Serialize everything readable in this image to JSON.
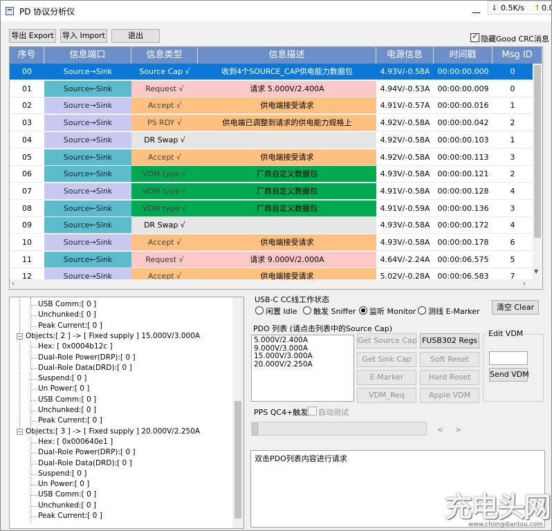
{
  "window": {
    "title": "PD 协议分析仪",
    "net_down": "0.5K/s",
    "net_up": "0.05"
  },
  "toolbar": {
    "export_label": "导出 Export",
    "import_label": "导入 Import",
    "exit_label": "退出",
    "hide_crc_label": "隐藏Good CRC消息"
  },
  "table": {
    "columns": [
      "序号",
      "信息端口",
      "信息类型",
      "信息描述",
      "电源信息",
      "时间戳",
      "Msg ID"
    ],
    "rows": [
      {
        "idx": "00",
        "port": "Source→Sink",
        "type": "Source Cap √",
        "desc": "收到4个SOURCE_CAP供电能力数据包",
        "power": "4.93V/-0.58A",
        "time": "00:00:00.000",
        "msg": "0",
        "type_color": "#0b78d8",
        "desc_color": "#0b78d8",
        "port_color": "#0b78d8"
      },
      {
        "idx": "01",
        "port": "Source←Sink",
        "type": "Request √",
        "desc": "请求 5.000V/2.400A",
        "power": "4.94V/-0.53A",
        "time": "00:00:00.009",
        "msg": "0",
        "type_color": "#ffc8c8",
        "desc_color": "#ffc8c8",
        "port_color": "#5cbccc"
      },
      {
        "idx": "02",
        "port": "Source→Sink",
        "type": "Accept √",
        "desc": "供电端接受请求",
        "power": "4.91V/-0.57A",
        "time": "00:00:00.016",
        "msg": "1",
        "type_color": "#ffc080",
        "desc_color": "#ffc080",
        "port_color": "#c8c8f0"
      },
      {
        "idx": "03",
        "port": "Source→Sink",
        "type": "PS RDY √",
        "desc": "供电端已调整到请求的供电能力规格上",
        "power": "4.92V/-0.58A",
        "time": "00:00:00.042",
        "msg": "2",
        "type_color": "#ffc080",
        "desc_color": "#ffc080",
        "port_color": "#c8c8f0"
      },
      {
        "idx": "04",
        "port": "Source→Sink",
        "type": "DR Swap √",
        "desc": "",
        "power": "4.92V/-0.58A",
        "time": "00:00:00.103",
        "msg": "1",
        "type_color": "#e6e6e6",
        "desc_color": "#e6e6e6",
        "port_color": "#c8c8f0"
      },
      {
        "idx": "05",
        "port": "Source←Sink",
        "type": "Accept √",
        "desc": "供电端接受请求",
        "power": "4.92V/-0.58A",
        "time": "00:00:00.113",
        "msg": "3",
        "type_color": "#ffc080",
        "desc_color": "#ffc080",
        "port_color": "#5cbccc"
      },
      {
        "idx": "06",
        "port": "Source←Sink",
        "type": "VDM type √",
        "desc": "厂商自定义数据包",
        "power": "4.93V/-0.58A",
        "time": "00:00:00.121",
        "msg": "2",
        "type_color": "#00a850",
        "desc_color": "#00a850",
        "port_color": "#5cbccc"
      },
      {
        "idx": "07",
        "port": "Source→Sink",
        "type": "VDM type √",
        "desc": "厂商自定义数据包",
        "power": "4.91V/-0.58A",
        "time": "00:00:00.128",
        "msg": "4",
        "type_color": "#00a850",
        "desc_color": "#00a850",
        "port_color": "#c8c8f0"
      },
      {
        "idx": "08",
        "port": "Source←Sink",
        "type": "VDM type √",
        "desc": "厂商自定义数据包",
        "power": "4.91V/-0.59A",
        "time": "00:00:00.136",
        "msg": "3",
        "type_color": "#00a850",
        "desc_color": "#00a850",
        "port_color": "#5cbccc"
      },
      {
        "idx": "09",
        "port": "Source←Sink",
        "type": "DR Swap √",
        "desc": "",
        "power": "4.93V/-0.58A",
        "time": "00:00:00.172",
        "msg": "4",
        "type_color": "#e6e6e6",
        "desc_color": "#e6e6e6",
        "port_color": "#5cbccc"
      },
      {
        "idx": "10",
        "port": "Source→Sink",
        "type": "Accept √",
        "desc": "供电端接受请求",
        "power": "4.93V/-0.58A",
        "time": "00:00:00.178",
        "msg": "6",
        "type_color": "#ffc080",
        "desc_color": "#ffc080",
        "port_color": "#c8c8f0"
      },
      {
        "idx": "11",
        "port": "Source←Sink",
        "type": "Request √",
        "desc": "请求 9.000V/2.000A",
        "power": "4.64V/-2.24A",
        "time": "00:00:06.575",
        "msg": "5",
        "type_color": "#ffc8c8",
        "desc_color": "#ffc8c8",
        "port_color": "#5cbccc"
      },
      {
        "idx": "12",
        "port": "Source→Sink",
        "type": "Accept √",
        "desc": "供电端接受请求",
        "power": "5.02V/-0.28A",
        "time": "00:00:06.583",
        "msg": "7",
        "type_color": "#ffc080",
        "desc_color": "#ffc080",
        "port_color": "#c8c8f0"
      }
    ]
  },
  "tree": {
    "lines": [
      {
        "text": "USB Comm:[ 0 ]",
        "level": 2
      },
      {
        "text": "Unchunked:[ 0 ]",
        "level": 2
      },
      {
        "text": "Peak Current:[ 0 ]",
        "level": 2
      },
      {
        "text": "Objects:[ 2 ] -> [ Fixed supply ] 15.000V/3.000A",
        "level": 1
      },
      {
        "text": "Hex: [ 0x0004b12c ]",
        "level": 2
      },
      {
        "text": "Dual-Role Power(DRP):[ 0 ]",
        "level": 2
      },
      {
        "text": "Dual-Role Data(DRD):[ 0 ]",
        "level": 2
      },
      {
        "text": "Suspend:[ 0 ]",
        "level": 2
      },
      {
        "text": "Un Power:[ 0 ]",
        "level": 2
      },
      {
        "text": "USB Comm:[ 0 ]",
        "level": 2
      },
      {
        "text": "Unchunked:[ 0 ]",
        "level": 2
      },
      {
        "text": "Peak Current:[ 0 ]",
        "level": 2
      },
      {
        "text": "Objects:[ 3 ] -> [ Fixed supply ] 20.000V/2.250A",
        "level": 1
      },
      {
        "text": "Hex: [ 0x000640e1 ]",
        "level": 2
      },
      {
        "text": "Dual-Role Power(DRP):[ 0 ]",
        "level": 2
      },
      {
        "text": "Dual-Role Data(DRD):[ 0 ]",
        "level": 2
      },
      {
        "text": "Suspend:[ 0 ]",
        "level": 2
      },
      {
        "text": "Un Power:[ 0 ]",
        "level": 2
      },
      {
        "text": "USB Comm:[ 0 ]",
        "level": 2
      },
      {
        "text": "Unchunked:[ 0 ]",
        "level": 2
      },
      {
        "text": "Peak Current:[ 0 ]",
        "level": 2
      }
    ]
  },
  "cc_state": {
    "title": "USB-C CC线工作状态",
    "options": [
      "闲置 Idle",
      "触发 Sniffer",
      "监听 Monitor",
      "测线 E-Marker"
    ],
    "selected": "监听 Monitor"
  },
  "clear_label": "清空 Clear",
  "pdo": {
    "title": "PDO 列表 (请点击列表中的Source Cap)",
    "items": [
      "5.000V/2.400A",
      "9.000V/3.000A",
      "15.000V/3.000A",
      "20.000V/2.250A"
    ]
  },
  "actions": {
    "get_source_cap": "Get Source Cap",
    "fusb302_regs": "FUSB302 Regs",
    "get_sink_cap": "Get Sink Cap",
    "soft_reset": "Soft Reset",
    "e_marker": "E-Marker",
    "hard_reset": "Hard Reset",
    "vdm_req": "VDM_Req",
    "apple_vdm": "Apple VDM"
  },
  "edit_vdm": {
    "title": "Edit VDM",
    "send_label": "Send VDM"
  },
  "pps": {
    "label": "PPS QC4+触发",
    "auto_test_label": "自动测试"
  },
  "log": {
    "text": "双击PDO列表内容进行请求"
  },
  "watermark": {
    "big": "充电头网",
    "small": "www.chongdiantou.com"
  }
}
